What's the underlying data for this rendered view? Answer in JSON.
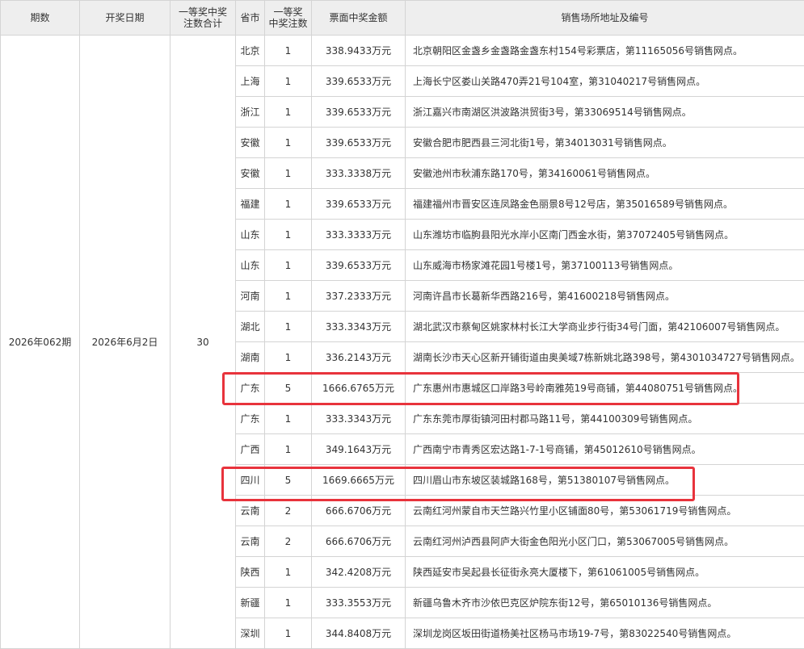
{
  "headers": {
    "issue": "期数",
    "date": "开奖日期",
    "total_line1": "一等奖中奖",
    "total_line2": "注数合计",
    "province": "省市",
    "count_line1": "一等奖",
    "count_line2": "中奖注数",
    "amount": "票面中奖金额",
    "address": "销售场所地址及编号"
  },
  "summary": {
    "issue": "2026年062期",
    "date": "2026年6月2日",
    "total": "30"
  },
  "highlight_color": "#e8333c",
  "rows": [
    {
      "province": "北京",
      "count": "1",
      "amount": "338.9433万元",
      "address": "北京朝阳区金盏乡金盏路金盏东村154号彩票店，第11165056号销售网点。"
    },
    {
      "province": "上海",
      "count": "1",
      "amount": "339.6533万元",
      "address": "上海长宁区娄山关路470弄21号104室，第31040217号销售网点。"
    },
    {
      "province": "浙江",
      "count": "1",
      "amount": "339.6533万元",
      "address": "浙江嘉兴市南湖区洪波路洪贸街3号，第33069514号销售网点。"
    },
    {
      "province": "安徽",
      "count": "1",
      "amount": "339.6533万元",
      "address": "安徽合肥市肥西县三河北街1号，第34013031号销售网点。"
    },
    {
      "province": "安徽",
      "count": "1",
      "amount": "333.3338万元",
      "address": "安徽池州市秋浦东路170号，第34160061号销售网点。"
    },
    {
      "province": "福建",
      "count": "1",
      "amount": "339.6533万元",
      "address": "福建福州市晋安区连凤路金色丽景8号12号店，第35016589号销售网点。"
    },
    {
      "province": "山东",
      "count": "1",
      "amount": "333.3333万元",
      "address": "山东潍坊市临朐县阳光水岸小区南门西金水街，第37072405号销售网点。"
    },
    {
      "province": "山东",
      "count": "1",
      "amount": "339.6533万元",
      "address": "山东威海市杨家滩花园1号楼1号，第37100113号销售网点。"
    },
    {
      "province": "河南",
      "count": "1",
      "amount": "337.2333万元",
      "address": "河南许昌市长葛新华西路216号，第41600218号销售网点。"
    },
    {
      "province": "湖北",
      "count": "1",
      "amount": "333.3343万元",
      "address": "湖北武汉市蔡甸区姚家林村长江大学商业步行街34号门面，第42106007号销售网点。"
    },
    {
      "province": "湖南",
      "count": "1",
      "amount": "336.2143万元",
      "address": "湖南长沙市天心区新开铺街道由奥美域7栋新姚北路398号，第4301034727号销售网点。"
    },
    {
      "province": "广东",
      "count": "5",
      "amount": "1666.6765万元",
      "address": "广东惠州市惠城区口岸路3号岭南雅苑19号商铺，第44080751号销售网点。"
    },
    {
      "province": "广东",
      "count": "1",
      "amount": "333.3343万元",
      "address": "广东东莞市厚街镇河田村郡马路11号，第44100309号销售网点。"
    },
    {
      "province": "广西",
      "count": "1",
      "amount": "349.1643万元",
      "address": "广西南宁市青秀区宏达路1-7-1号商铺，第45012610号销售网点。"
    },
    {
      "province": "四川",
      "count": "5",
      "amount": "1669.6665万元",
      "address": "四川眉山市东坡区装城路168号，第51380107号销售网点。"
    },
    {
      "province": "云南",
      "count": "2",
      "amount": "666.6706万元",
      "address": "云南红河州蒙自市天竺路兴竹里小区铺面80号，第53061719号销售网点。"
    },
    {
      "province": "云南",
      "count": "2",
      "amount": "666.6706万元",
      "address": "云南红河州泸西县阿庐大街金色阳光小区门口，第53067005号销售网点。"
    },
    {
      "province": "陕西",
      "count": "1",
      "amount": "342.4208万元",
      "address": "陕西延安市吴起县长征街永亮大厦楼下，第61061005号销售网点。"
    },
    {
      "province": "新疆",
      "count": "1",
      "amount": "333.3553万元",
      "address": "新疆乌鲁木齐市沙依巴克区炉院东街12号，第65010136号销售网点。"
    },
    {
      "province": "深圳",
      "count": "1",
      "amount": "344.8408万元",
      "address": "深圳龙岗区坂田街道杨美社区杨马市场19-7号，第83022540号销售网点。"
    }
  ]
}
